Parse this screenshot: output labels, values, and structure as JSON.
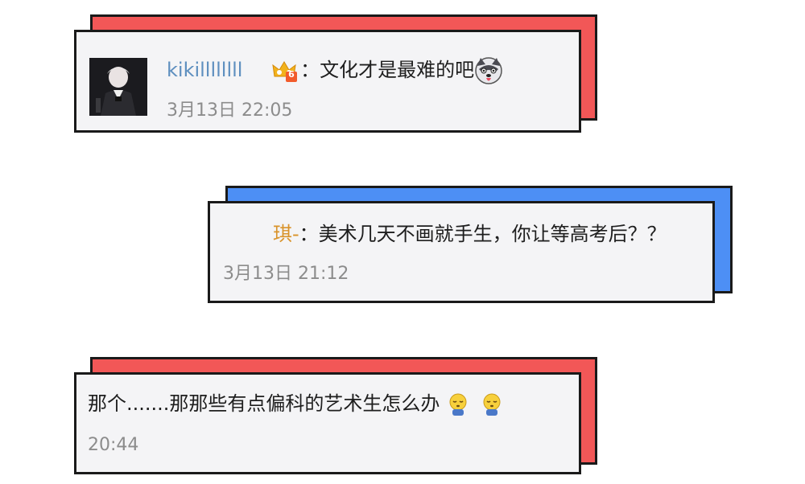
{
  "comments": [
    {
      "username": "kikillllllll",
      "separator": "：",
      "text": "文化才是最难的吧",
      "timestamp": "3月13日 22:05",
      "badge_number": "6",
      "badge_icon": "crown-badge-icon",
      "trailing_icon": "husky-dog-emoji-icon",
      "shadow_color": "#f25757"
    },
    {
      "username": "琪-",
      "separator": "：",
      "text": "美术几天不画就手生，你让等高考后？？",
      "timestamp": "3月13日 21:12",
      "shadow_color": "#4d8ff5"
    },
    {
      "text": "那个.......那那些有点偏科的艺术生怎么办",
      "timestamp": "20:44",
      "trailing_icon": "crying-emoji-icon",
      "shadow_color": "#f25757"
    }
  ]
}
